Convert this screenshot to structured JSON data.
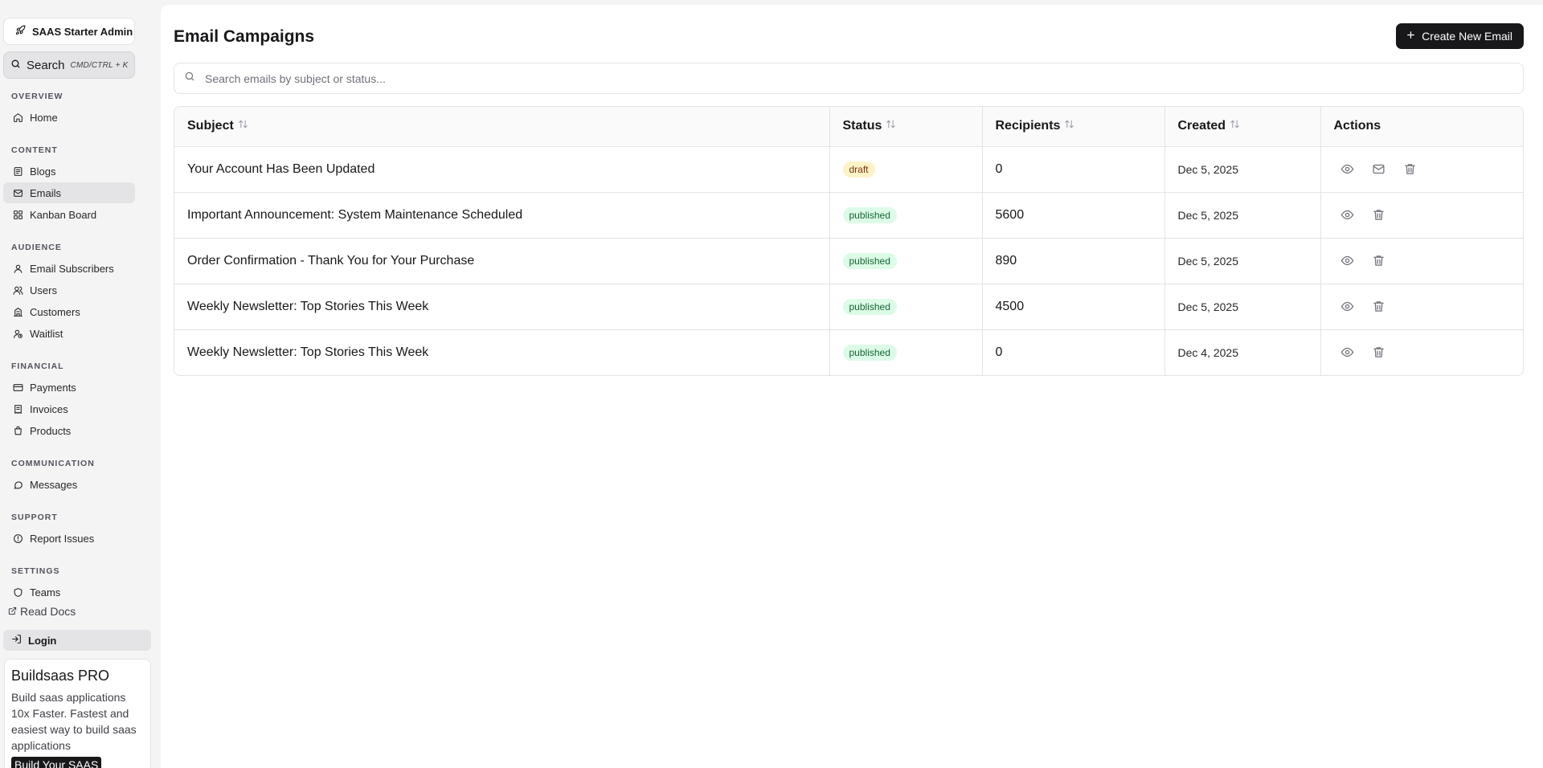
{
  "sidebar": {
    "brand": "SAAS Starter Admin",
    "search_label": "Search",
    "search_shortcut": "CMD/CTRL + K",
    "sections": [
      {
        "label": "OVERVIEW",
        "items": [
          {
            "label": "Home",
            "icon": "home-icon"
          }
        ]
      },
      {
        "label": "CONTENT",
        "items": [
          {
            "label": "Blogs",
            "icon": "document-icon"
          },
          {
            "label": "Emails",
            "icon": "mail-icon",
            "active": true
          },
          {
            "label": "Kanban Board",
            "icon": "grid-icon"
          }
        ]
      },
      {
        "label": "AUDIENCE",
        "items": [
          {
            "label": "Email Subscribers",
            "icon": "user-icon"
          },
          {
            "label": "Users",
            "icon": "users-icon"
          },
          {
            "label": "Customers",
            "icon": "building-icon"
          },
          {
            "label": "Waitlist",
            "icon": "user-clock-icon"
          }
        ]
      },
      {
        "label": "FINANCIAL",
        "items": [
          {
            "label": "Payments",
            "icon": "credit-card-icon"
          },
          {
            "label": "Invoices",
            "icon": "receipt-icon"
          },
          {
            "label": "Products",
            "icon": "package-icon"
          }
        ]
      },
      {
        "label": "COMMUNICATION",
        "items": [
          {
            "label": "Messages",
            "icon": "message-icon"
          }
        ]
      },
      {
        "label": "SUPPORT",
        "items": [
          {
            "label": "Report Issues",
            "icon": "alert-circle-icon"
          }
        ]
      },
      {
        "label": "SETTINGS",
        "items": [
          {
            "label": "Teams",
            "icon": "shield-icon"
          }
        ]
      }
    ],
    "read_docs": "Read Docs",
    "login": "Login",
    "promo": {
      "title": "Buildsaas PRO",
      "text": "Build saas applications 10x Faster. Fastest and easiest way to build saas applications",
      "button": "Build Your SAAS"
    }
  },
  "main": {
    "title": "Email Campaigns",
    "create_button": "Create New Email",
    "search_placeholder": "Search emails by subject or status...",
    "columns": {
      "subject": "Subject",
      "status": "Status",
      "recipients": "Recipients",
      "created": "Created",
      "actions": "Actions"
    },
    "rows": [
      {
        "subject": "Your Account Has Been Updated",
        "status": "draft",
        "recipients": "0",
        "created": "Dec 5, 2025",
        "can_send": true
      },
      {
        "subject": "Important Announcement: System Maintenance Scheduled",
        "status": "published",
        "recipients": "5600",
        "created": "Dec 5, 2025",
        "can_send": false
      },
      {
        "subject": "Order Confirmation - Thank You for Your Purchase",
        "status": "published",
        "recipients": "890",
        "created": "Dec 5, 2025",
        "can_send": false
      },
      {
        "subject": "Weekly Newsletter: Top Stories This Week",
        "status": "published",
        "recipients": "4500",
        "created": "Dec 5, 2025",
        "can_send": false
      },
      {
        "subject": "Weekly Newsletter: Top Stories This Week",
        "status": "published",
        "recipients": "0",
        "created": "Dec 4, 2025",
        "can_send": false
      }
    ]
  }
}
